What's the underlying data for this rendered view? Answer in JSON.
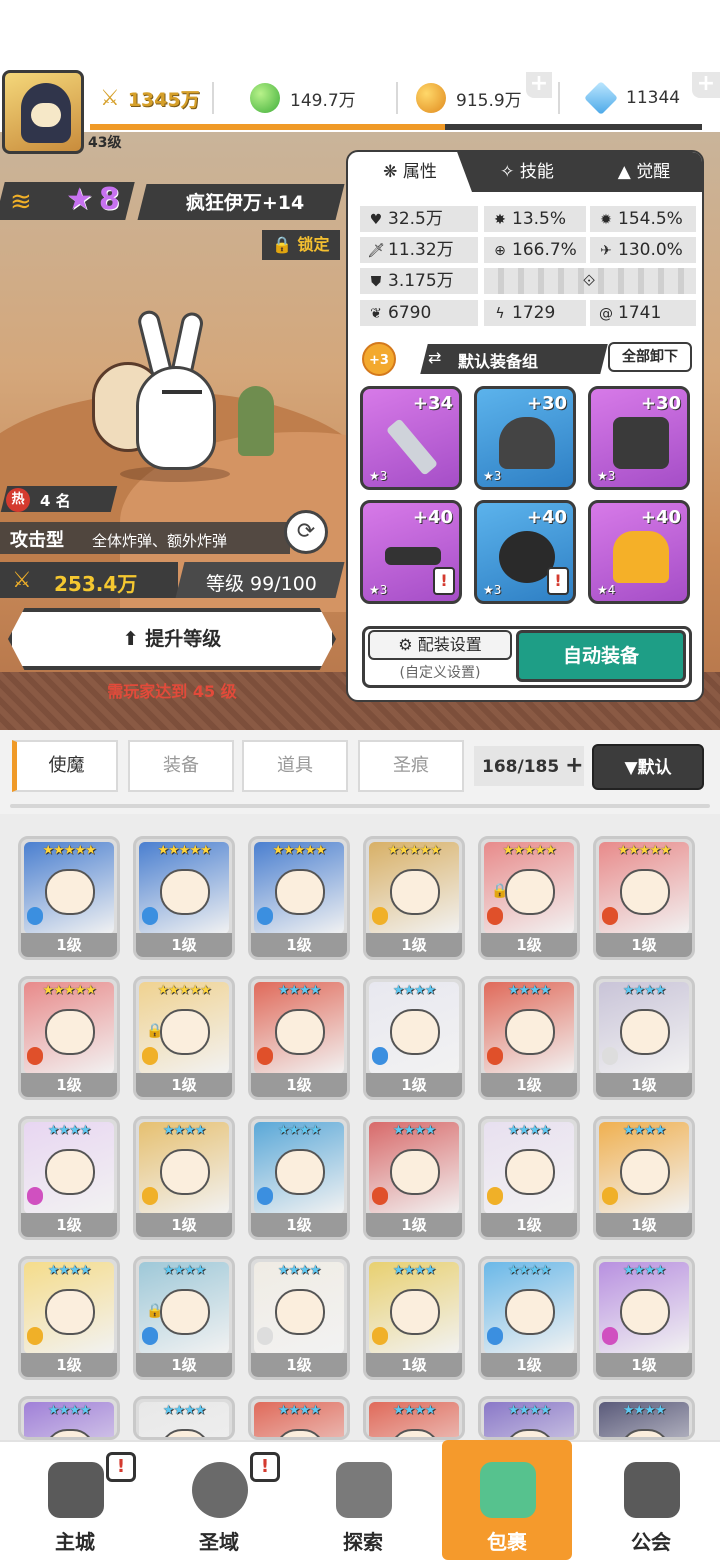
{
  "player": {
    "level_label": "43级",
    "xp_fraction": 0.58
  },
  "resources": {
    "power": "1345万",
    "green": "149.7万",
    "gold": "915.9万",
    "diamond": "11344"
  },
  "hero": {
    "rank_stars": "8",
    "name": "疯狂伊万+14",
    "lock_label": "锁定",
    "hot_badge": "热",
    "hot_rank": "4 名",
    "type_label": "攻击型",
    "type_desc": "全体炸弹、额外炸弹",
    "power": "253.4万",
    "level_text": "等级 99/100",
    "upgrade_label": "提升等级",
    "requirement": "需玩家达到 45 级"
  },
  "panel": {
    "tabs": [
      "属性",
      "技能",
      "觉醒"
    ],
    "stats": {
      "hp": "32.5万",
      "crit": "13.5%",
      "crit_dmg": "154.5%",
      "atk": "11.32万",
      "acc": "166.7%",
      "speed": "130.0%",
      "def": "3.175万",
      "s1": "6790",
      "s2": "1729",
      "s3": "1741"
    },
    "equip_badge": "+3",
    "equip_set_name": "默认装备组",
    "unload_all": "全部卸下",
    "slots": [
      {
        "plus": "+34",
        "stars": "★3",
        "color": "purple",
        "warn": false
      },
      {
        "plus": "+30",
        "stars": "★3",
        "color": "blue",
        "warn": false
      },
      {
        "plus": "+30",
        "stars": "★3",
        "color": "purple",
        "warn": false
      },
      {
        "plus": "+40",
        "stars": "★3",
        "color": "purple",
        "warn": true
      },
      {
        "plus": "+40",
        "stars": "★3",
        "color": "blue",
        "warn": true
      },
      {
        "plus": "+40",
        "stars": "★4",
        "color": "purple",
        "warn": false
      }
    ],
    "config_label": "配装设置",
    "config_sub": "(自定义设置)",
    "auto_equip": "自动装备"
  },
  "categories": [
    "使魔",
    "装备",
    "道具",
    "圣痕"
  ],
  "inventory_count": "168/185",
  "sort_label": "▼默认",
  "grid_rows": [
    [
      {
        "stars": "★★★★★",
        "star_color": "gold",
        "bg": "#4a7fd0",
        "elem": "#3b8fe0",
        "lock": false
      },
      {
        "stars": "★★★★★",
        "star_color": "gold",
        "bg": "#4a7fd0",
        "elem": "#3b8fe0",
        "lock": false
      },
      {
        "stars": "★★★★★",
        "star_color": "gold",
        "bg": "#4a7fd0",
        "elem": "#3b8fe0",
        "lock": false
      },
      {
        "stars": "★★★★★",
        "star_color": "gold",
        "bg": "#d8b066",
        "elem": "#f0b028",
        "lock": false
      },
      {
        "stars": "★★★★★",
        "star_color": "gold",
        "bg": "#e88a8a",
        "elem": "#e0502a",
        "lock": true
      },
      {
        "stars": "★★★★★",
        "star_color": "gold",
        "bg": "#e88a8a",
        "elem": "#e0502a",
        "lock": false
      }
    ],
    [
      {
        "stars": "★★★★★",
        "star_color": "gold",
        "bg": "#e88a8a",
        "elem": "#e0502a",
        "lock": false
      },
      {
        "stars": "★★★★★",
        "star_color": "gold",
        "bg": "#f0d290",
        "elem": "#f0b028",
        "lock": true
      },
      {
        "stars": "★★★★",
        "star_color": "blue",
        "bg": "#e06a5a",
        "elem": "#e0502a",
        "lock": false
      },
      {
        "stars": "★★★★",
        "star_color": "blue",
        "bg": "#e8e8f0",
        "elem": "#3b8fe0",
        "lock": false
      },
      {
        "stars": "★★★★",
        "star_color": "blue",
        "bg": "#e06a5a",
        "elem": "#e0502a",
        "lock": false
      },
      {
        "stars": "★★★★",
        "star_color": "blue",
        "bg": "#c9c4d8",
        "elem": "#dddddd",
        "lock": false
      }
    ],
    [
      {
        "stars": "★★★★",
        "star_color": "blue",
        "bg": "#e8d6f2",
        "elem": "#d050c0",
        "lock": false
      },
      {
        "stars": "★★★★",
        "star_color": "blue",
        "bg": "#e6c070",
        "elem": "#f0b028",
        "lock": false
      },
      {
        "stars": "★★★★",
        "star_color": "blue",
        "bg": "#5aa8d8",
        "elem": "#3b8fe0",
        "lock": false
      },
      {
        "stars": "★★★★",
        "star_color": "blue",
        "bg": "#d86a6a",
        "elem": "#e0502a",
        "lock": false
      },
      {
        "stars": "★★★★",
        "star_color": "blue",
        "bg": "#e8e0f0",
        "elem": "#f0b028",
        "lock": false
      },
      {
        "stars": "★★★★",
        "star_color": "blue",
        "bg": "#f0b050",
        "elem": "#f0b028",
        "lock": false
      }
    ],
    [
      {
        "stars": "★★★★",
        "star_color": "blue",
        "bg": "#f5dc8a",
        "elem": "#f0b028",
        "lock": false
      },
      {
        "stars": "★★★★",
        "star_color": "blue",
        "bg": "#9ec8d8",
        "elem": "#3b8fe0",
        "lock": true
      },
      {
        "stars": "★★★★",
        "star_color": "blue",
        "bg": "#f0ece4",
        "elem": "#dddddd",
        "lock": false
      },
      {
        "stars": "★★★★",
        "star_color": "blue",
        "bg": "#e8d070",
        "elem": "#f0b028",
        "lock": false
      },
      {
        "stars": "★★★★",
        "star_color": "blue",
        "bg": "#6ab8e8",
        "elem": "#3b8fe0",
        "lock": false
      },
      {
        "stars": "★★★★",
        "star_color": "blue",
        "bg": "#b890e0",
        "elem": "#d050c0",
        "lock": false
      }
    ],
    [
      {
        "stars": "★★★★",
        "star_color": "blue",
        "bg": "#a080d8",
        "elem": "#d050c0",
        "lock": false
      },
      {
        "stars": "★★★★",
        "star_color": "blue",
        "bg": "#e8e8e8",
        "elem": "#dddddd",
        "lock": false
      },
      {
        "stars": "★★★★",
        "star_color": "blue",
        "bg": "#e06a5a",
        "elem": "#e0502a",
        "lock": false
      },
      {
        "stars": "★★★★",
        "star_color": "blue",
        "bg": "#e06a5a",
        "elem": "#e0502a",
        "lock": false
      },
      {
        "stars": "★★★★",
        "star_color": "blue",
        "bg": "#8a78c8",
        "elem": "#d050c0",
        "lock": false
      },
      {
        "stars": "★★★★",
        "star_color": "blue",
        "bg": "#5a5a7a",
        "elem": "#3b8fe0",
        "lock": false
      }
    ]
  ],
  "card_level_label": "1级",
  "nav": [
    {
      "label": "主城",
      "icon": "castle-icon",
      "badge": true
    },
    {
      "label": "圣域",
      "icon": "portal-icon",
      "badge": true
    },
    {
      "label": "探索",
      "icon": "sword-icon",
      "badge": false
    },
    {
      "label": "包裹",
      "icon": "bag-icon",
      "badge": false,
      "active": true
    },
    {
      "label": "公会",
      "icon": "guild-icon",
      "badge": false
    }
  ]
}
